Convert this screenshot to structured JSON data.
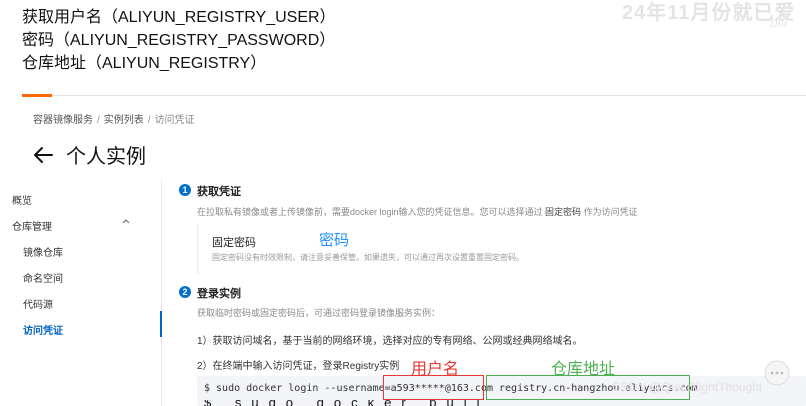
{
  "caption": {
    "line1": "获取用户名（ALIYUN_REGISTRY_USER）",
    "line2": "密码（ALIYUN_REGISTRY_PASSWORD）",
    "line3": "仓库地址（ALIYUN_REGISTRY）"
  },
  "watermark": {
    "top_text": "24年11月份就已爱",
    "bili": "bili",
    "bottom_text": "CSDN @QuietNightThought"
  },
  "breadcrumb": {
    "items": [
      "容器镜像服务",
      "实例列表",
      "访问凭证"
    ],
    "separator": "/"
  },
  "page": {
    "title": "个人实例"
  },
  "sidebar": {
    "items": [
      {
        "label": "概览"
      },
      {
        "label": "仓库管理"
      },
      {
        "label": "镜像仓库"
      },
      {
        "label": "命名空间"
      },
      {
        "label": "代码源"
      },
      {
        "label": "访问凭证"
      }
    ]
  },
  "step1": {
    "number": "1",
    "title": "获取凭证",
    "desc_prefix": "在拉取私有镜像或者上传镜像前，需要docker login输入您的凭证信息。您可以选择通过",
    "desc_link": "固定密码",
    "desc_suffix": "作为访问凭证",
    "fixed_label": "固定密码",
    "fixed_note": "固定密码没有时效限制，请注意妥善保管。如果遗失，可以通过再次设置重置固定密码。"
  },
  "step2": {
    "number": "2",
    "title": "登录实例",
    "desc": "获取临时密码或固定密码后，可通过密码登录镜像服务实例：",
    "line1": "1）获取访问域名，基于当前的网络环境，选择对应的专有网络、公网或经典网络域名。",
    "line2": "2）在终端中输入访问凭证，登录Registry实例",
    "code_prefix": "$ sudo docker login --username=",
    "code_user": "a593*****@163.com",
    "code_registry": " registry.cn-hangzhou.aliyuncs.com",
    "code_second_line": "$ sudo docker pull"
  },
  "annotations": {
    "password": "密码",
    "username": "用户名",
    "registry": "仓库地址"
  },
  "colors": {
    "accent_orange": "#ff6a00",
    "link_blue": "#0064c8",
    "annotation_red": "#e53935",
    "annotation_green": "#4caf50",
    "annotation_blue": "#1e90ff"
  }
}
